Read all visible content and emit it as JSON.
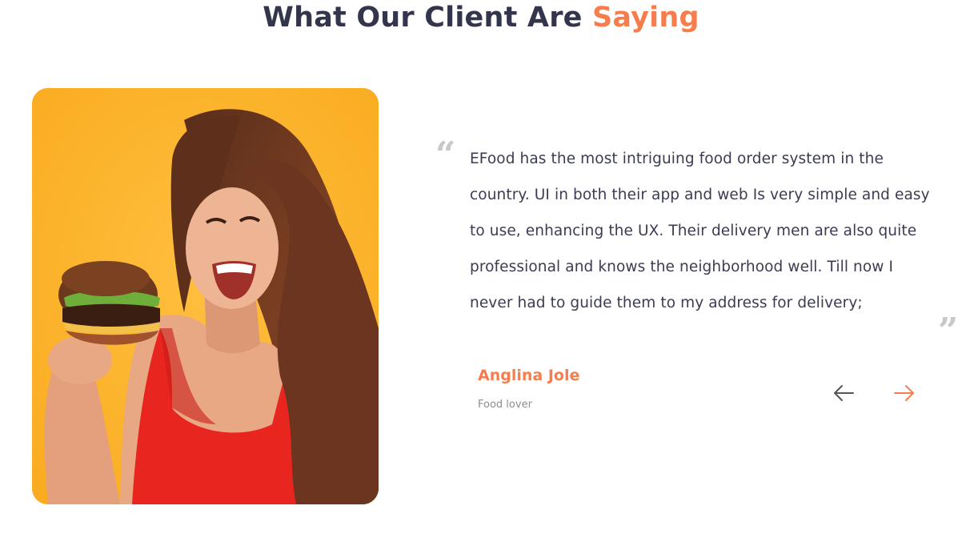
{
  "section": {
    "heading_main": "What Our Client Are",
    "heading_accent": "Saying"
  },
  "colors": {
    "accent": "#f67d4c",
    "heading": "#33354d",
    "body_text": "#3b3c52",
    "muted": "#8e8e8e",
    "photo_background": "#ffb52e"
  },
  "testimonial": {
    "text": "EFood has the most intriguing food order system in the country. UI in both their app and web Is very simple and easy to use, enhancing the UX. Their delivery men are also quite professional and knows the neighborhood well. Till now I never had to guide them to my address for delivery;",
    "author_name": "Anglina Jole",
    "author_role": "Food lover",
    "photo_icon": "woman-eating-burger-photo"
  },
  "quotes": {
    "open": "“",
    "close": "”"
  },
  "navigation": {
    "prev_icon": "arrow-left-icon",
    "next_icon": "arrow-right-icon"
  }
}
